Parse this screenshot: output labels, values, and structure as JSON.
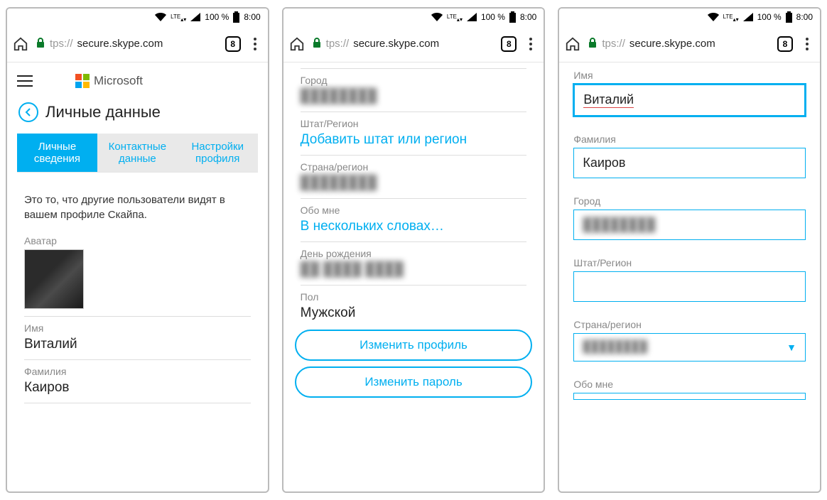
{
  "status": {
    "lte": "LTE",
    "battery_pct": "100 %",
    "time": "8:00"
  },
  "browser": {
    "url_proto": "tps://",
    "url_host": "secure.skype.com",
    "tab_count": "8"
  },
  "screen1": {
    "brand": "Microsoft",
    "page_title": "Личные данные",
    "tabs": {
      "personal": "Личные сведения",
      "contact": "Контактные данные",
      "profile": "Настройки профиля"
    },
    "description": "Это то, что другие пользователи видят в вашем профиле Скайпа.",
    "avatar_label": "Аватар",
    "name_label": "Имя",
    "name_value": "Виталий",
    "surname_label": "Фамилия",
    "surname_value": "Каиров"
  },
  "screen2": {
    "city_label": "Город",
    "city_value": "████████",
    "state_label": "Штат/Регион",
    "state_link": "Добавить штат или регион",
    "country_label": "Страна/регион",
    "country_value": "████████",
    "about_label": "Обо мне",
    "about_link": "В нескольких словах…",
    "birthday_label": "День рождения",
    "birthday_value": "██ ████ ████",
    "gender_label": "Пол",
    "gender_value": "Мужской",
    "edit_profile_btn": "Изменить профиль",
    "change_password_btn": "Изменить пароль"
  },
  "screen3": {
    "name_label": "Имя",
    "name_value": "Виталий",
    "surname_label": "Фамилия",
    "surname_value": "Каиров",
    "city_label": "Город",
    "city_value": "████████",
    "state_label": "Штат/Регион",
    "state_value": "",
    "country_label": "Страна/регион",
    "country_value": "████████",
    "about_label": "Обо мне"
  }
}
